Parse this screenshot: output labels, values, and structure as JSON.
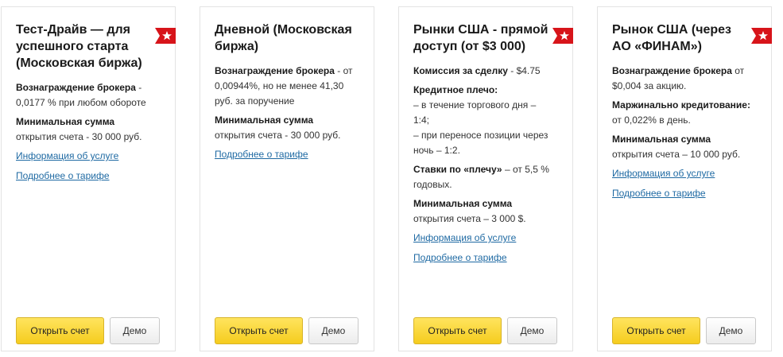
{
  "colors": {
    "accent_yellow": "#f5cc1e",
    "link_blue": "#1f6aa3",
    "ribbon_red": "#d7141a"
  },
  "cards": [
    {
      "title": "Тест-Драйв — для успешного старта (Московская биржа)",
      "p1_bold": "Вознаграждение брокера",
      "p1_text": " - 0,0177 % при любом обороте",
      "p2_bold": "Минимальная сумма",
      "p2_text": " открытия счета - 30 000 руб.",
      "link1": "Информация об услуге",
      "link2": "Подробнее о тарифе",
      "btn_open": "Открыть счет",
      "btn_demo": "Демо",
      "badge_icon": "star-icon"
    },
    {
      "title": "Дневной (Московская биржа)",
      "p1_bold": "Вознаграждение брокера",
      "p1_text": " - от 0,00944%, но не менее 41,30 руб. за поручение",
      "p2_bold": "Минимальная сумма",
      "p2_text": " открытия счета - 30 000 руб.",
      "link1": "Подробнее о тарифе",
      "btn_open": "Открыть счет",
      "btn_demo": "Демо"
    },
    {
      "title": "Рынки США - прямой доступ (от $3 000)",
      "p1_bold": "Комиссия за сделку",
      "p1_text": " - $4.75",
      "p2_bold": "Кредитное плечо:",
      "p2_lines": [
        "– в течение торгового дня – 1:4;",
        "– при переносе позиции через ночь – 1:2."
      ],
      "p3_bold": "Ставки по «плечу»",
      "p3_text": " – от 5,5 % годовых.",
      "p4_bold": "Минимальная сумма",
      "p4_text": " открытия счета – 3 000 $.",
      "link1": "Информация об услуге",
      "link2": "Подробнее о тарифе",
      "btn_open": "Открыть счет",
      "btn_demo": "Демо",
      "badge_icon": "star-icon"
    },
    {
      "title": "Рынок США (через АО «ФИНАМ»)",
      "p1_bold": "Вознаграждение брокера",
      "p1_text": " от $0,004 за акцию.",
      "p2_bold": "Маржинально кредитование:",
      "p2_text": " от 0,022% в день.",
      "p3_bold": "Минимальная сумма",
      "p3_text": " открытия счета – 10 000 руб.",
      "link1": "Информация об услуге",
      "link2": "Подробнее о тарифе",
      "btn_open": "Открыть счет",
      "btn_demo": "Демо",
      "badge_icon": "star-icon"
    }
  ]
}
